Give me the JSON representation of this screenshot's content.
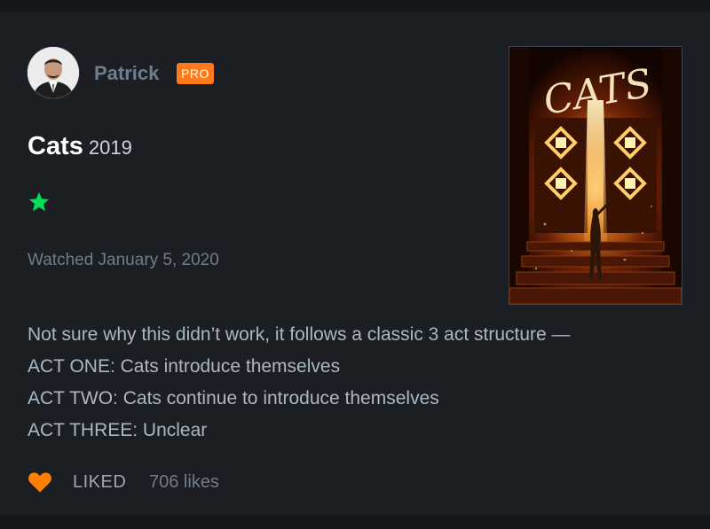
{
  "review": {
    "username": "Patrick",
    "badge": "PRO",
    "film_title": "Cats",
    "film_year": "2019",
    "rating_stars": 1,
    "watched_date": "Watched January 5, 2020",
    "body_lines": [
      "Not sure why this didn’t work, it follows a classic 3 act structure —",
      "ACT ONE: Cats introduce themselves",
      "ACT TWO: Cats continue to introduce themselves",
      "ACT THREE: Unclear"
    ],
    "liked_label": "LIKED",
    "likes_count": "706 likes",
    "poster_title": "CATS"
  },
  "colors": {
    "background": "#14181c",
    "card": "#1b1f24",
    "star": "#00e054",
    "heart": "#ff8000",
    "badge": "#ff7a1a"
  },
  "icons": {
    "rating": "star-icon",
    "like": "heart-icon"
  }
}
